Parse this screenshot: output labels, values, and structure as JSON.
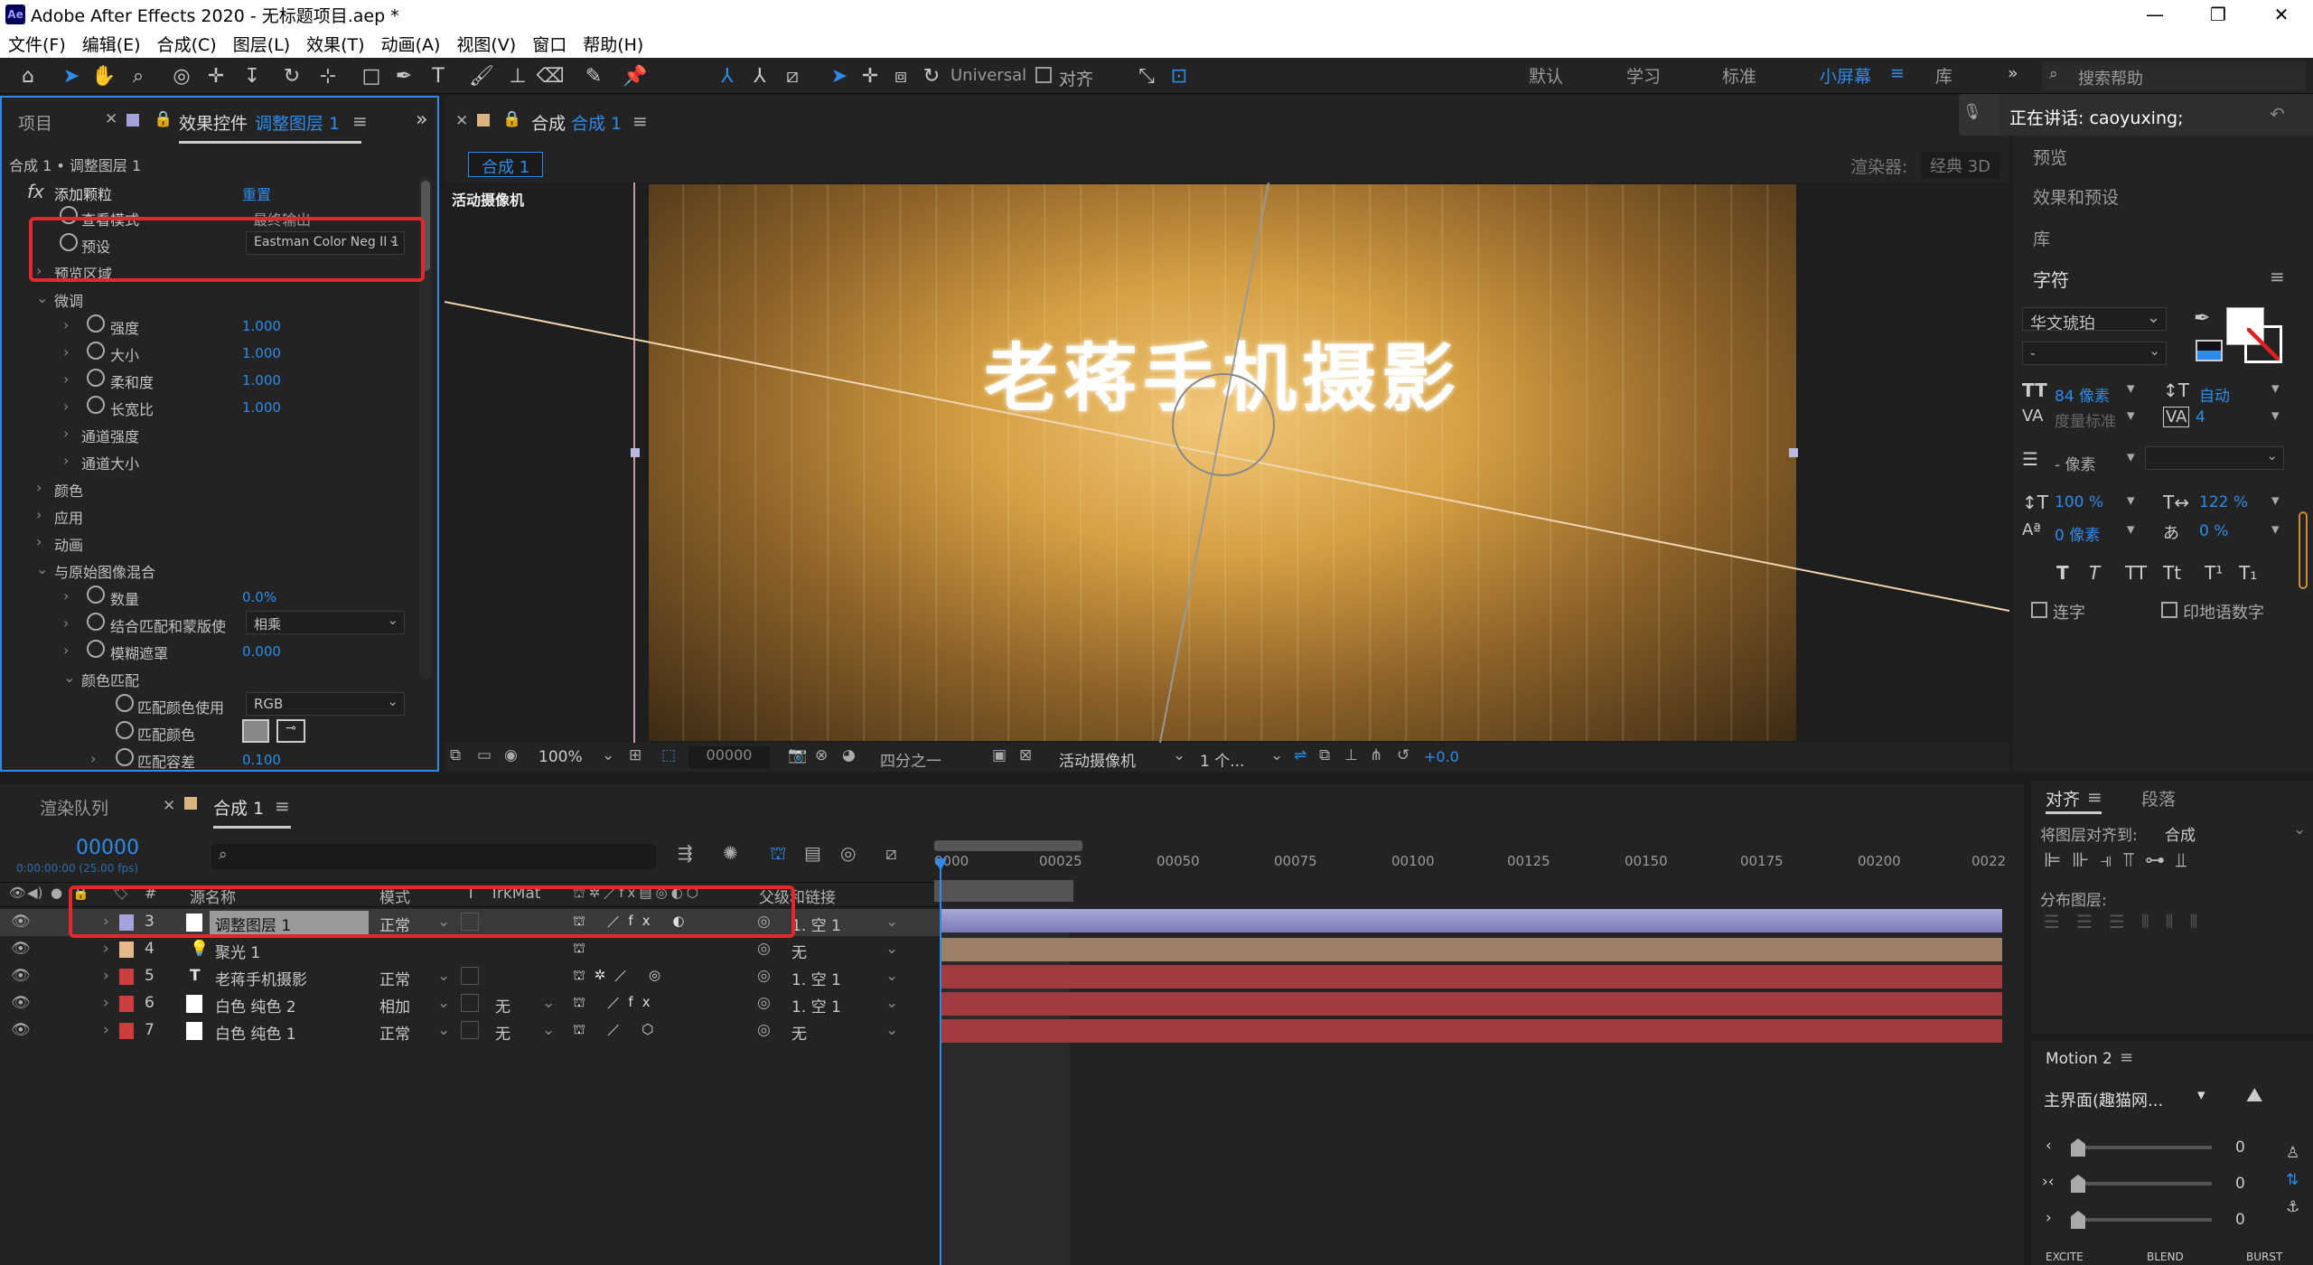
{
  "app": {
    "title": "Adobe After Effects 2020 - 无标题项目.aep *",
    "logo": "Ae"
  },
  "menu": [
    "文件(F)",
    "编辑(E)",
    "合成(C)",
    "图层(L)",
    "效果(T)",
    "动画(A)",
    "视图(V)",
    "窗口",
    "帮助(H)"
  ],
  "toolbar": {
    "universal": "Universal",
    "align": "对齐"
  },
  "workspaces": [
    "默认",
    "学习",
    "标准",
    "小屏幕",
    "库"
  ],
  "active_workspace": "小屏幕",
  "search_help": "搜索帮助",
  "speaking": "正在讲话: caoyuxing;",
  "project_tab": "项目",
  "effects_tab": {
    "label": "效果控件",
    "layer": "调整图层 1"
  },
  "effects_path": "合成 1 • 调整图层 1",
  "effect": {
    "name": "添加颗粒",
    "reset": "重置",
    "view_mode": {
      "label": "查看模式",
      "value": "最终输出"
    },
    "preset": {
      "label": "预设",
      "value": "Eastman Color Neg II 1"
    },
    "preview_region": "预览区域",
    "tweak": "微调",
    "intensity": {
      "label": "强度",
      "value": "1.000"
    },
    "size": {
      "label": "大小",
      "value": "1.000"
    },
    "softness": {
      "label": "柔和度",
      "value": "1.000"
    },
    "aspect": {
      "label": "长宽比",
      "value": "1.000"
    },
    "channel_intensity": "通道强度",
    "channel_size": "通道大小",
    "color": "颜色",
    "application": "应用",
    "animation": "动画",
    "blend": "与原始图像混合",
    "amount": {
      "label": "数量",
      "value": "0.0%"
    },
    "combine": {
      "label": "结合匹配和蒙版使",
      "value": "相乘"
    },
    "blur_matte": {
      "label": "模糊遮罩",
      "value": "0.000"
    },
    "color_match": "颜色匹配",
    "match_using": {
      "label": "匹配颜色使用",
      "value": "RGB"
    },
    "match_color": "匹配颜色",
    "match_tol": {
      "label": "匹配容差",
      "value": "0.100"
    }
  },
  "comp_tab": {
    "label": "合成",
    "name": "合成 1"
  },
  "comp_crumb": "合成 1",
  "renderer": {
    "label": "渲染器:",
    "value": "经典 3D"
  },
  "camera_label": "活动摄像机",
  "comp_text": "老蒋手机摄影",
  "viewer_bar": {
    "zoom": "100%",
    "timecode": "00000",
    "res": "四分之一",
    "camera": "活动摄像机",
    "views": "1 个...",
    "exposure": "+0.0"
  },
  "right_panels": [
    "预览",
    "效果和预设",
    "库"
  ],
  "character": {
    "title": "字符",
    "font": "华文琥珀",
    "style": "-",
    "size": "84 像素",
    "leading": "自动",
    "kerning": "度量标准",
    "tracking": "4",
    "stroke": "- 像素",
    "vscale": "100 %",
    "hscale": "122 %",
    "baseline": "0 像素",
    "tsume": "0 %",
    "styles": [
      "T",
      "T",
      "TT",
      "Tt",
      "T¹",
      "T₁"
    ],
    "ligatures": "连字",
    "hindi": "印地语数字"
  },
  "timeline_tabs": {
    "render": "渲染队列",
    "comp": "合成 1"
  },
  "timecode": {
    "value": "00000",
    "sub": "0:00:00:00 (25.00 fps)"
  },
  "ruler": [
    "0000",
    "00025",
    "00050",
    "00075",
    "00100",
    "00125",
    "00150",
    "00175",
    "00200",
    "0022"
  ],
  "columns": {
    "num": "#",
    "source": "源名称",
    "mode": "模式",
    "t": "T",
    "trkmat": "TrkMat",
    "parent": "父级和链接"
  },
  "layers": [
    {
      "num": "3",
      "name": "调整图层 1",
      "mode": "正常",
      "trk": "",
      "parent": "1. 空 1",
      "label": "#a3a3d9",
      "bar": "#8e8ec8",
      "selected": true
    },
    {
      "num": "4",
      "name": "聚光 1",
      "mode": "",
      "trk": "",
      "parent": "无",
      "label": "#e8b98a",
      "bar": "#9c8066",
      "selected": false
    },
    {
      "num": "5",
      "name": "老蒋手机摄影",
      "mode": "正常",
      "trk": "",
      "parent": "1. 空 1",
      "label": "#cc3d3d",
      "bar": "#a33a3f",
      "selected": false
    },
    {
      "num": "6",
      "name": "白色 纯色 2",
      "mode": "相加",
      "trk": "无",
      "parent": "1. 空 1",
      "label": "#cc3d3d",
      "bar": "#a33a3f",
      "selected": false
    },
    {
      "num": "7",
      "name": "白色 纯色 1",
      "mode": "正常",
      "trk": "无",
      "parent": "无",
      "label": "#cc3d3d",
      "bar": "#a33a3f",
      "selected": false
    }
  ],
  "align": {
    "tab": "对齐",
    "para": "段落",
    "align_to_label": "将图层对齐到:",
    "align_to": "合成",
    "distribute": "分布图层:"
  },
  "motion": {
    "title": "Motion 2",
    "preset": "主界面(趣猫网...",
    "values": [
      "0",
      "0",
      "0"
    ],
    "buttons": [
      "EXCITE",
      "BLEND",
      "BURST"
    ]
  }
}
